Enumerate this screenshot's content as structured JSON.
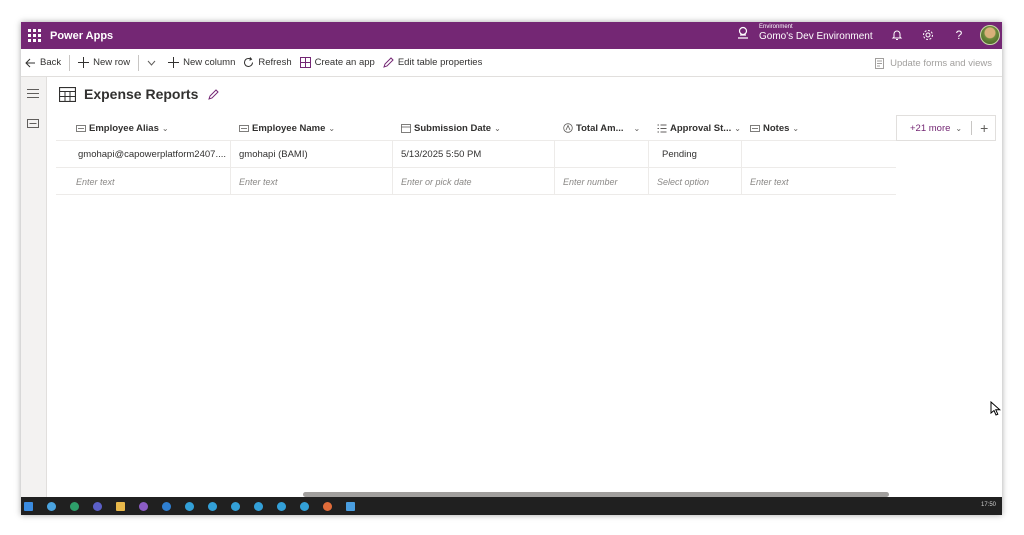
{
  "header": {
    "app_title": "Power Apps",
    "environment_caption": "Environment",
    "environment_name": "Gomo's Dev Environment",
    "accent": "#742774"
  },
  "commands": {
    "back": "Back",
    "new_row": "New row",
    "new_column": "New column",
    "refresh": "Refresh",
    "create_app": "Create an app",
    "edit_table": "Edit table properties",
    "update_forms": "Update forms and views"
  },
  "table": {
    "title": "Expense Reports",
    "columns": [
      {
        "label": "Employee Alias",
        "icon": "text-field-icon"
      },
      {
        "label": "Employee Name",
        "icon": "text-field-icon"
      },
      {
        "label": "Submission Date",
        "icon": "calendar-icon"
      },
      {
        "label": "Total Am...",
        "icon": "currency-icon"
      },
      {
        "label": "Approval St...",
        "icon": "choice-icon"
      },
      {
        "label": "Notes",
        "icon": "text-field-icon"
      }
    ],
    "rows": [
      [
        "gmohapi@capowerplatform2407....",
        "gmohapi (BAMI)",
        "5/13/2025 5:50 PM",
        "",
        "Pending",
        ""
      ]
    ],
    "placeholders": [
      "Enter text",
      "Enter text",
      "Enter or pick date",
      "Enter number",
      "Select option",
      "Enter text"
    ],
    "more_columns": "+21 more"
  },
  "taskbar": {
    "time": "17:50"
  }
}
